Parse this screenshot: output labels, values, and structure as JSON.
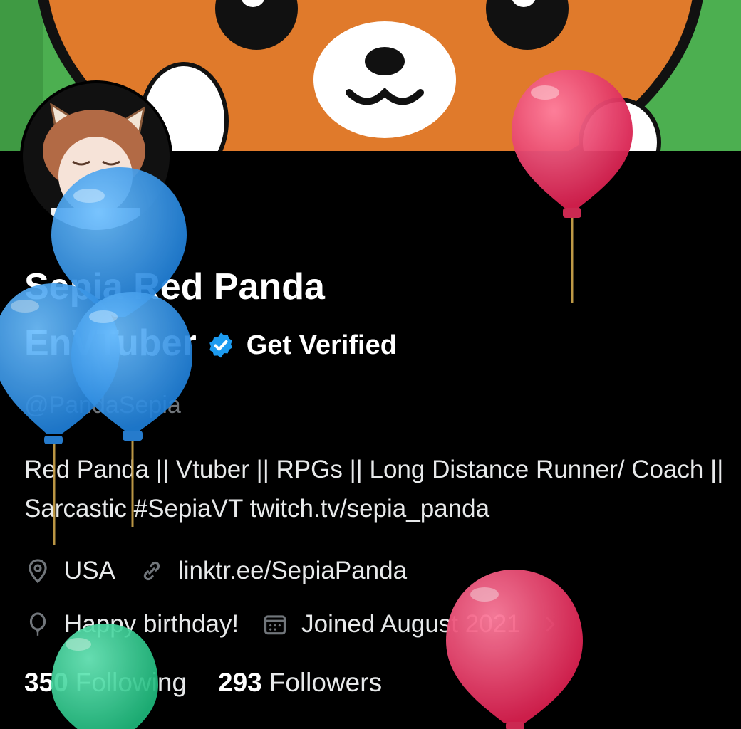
{
  "profile": {
    "name_line1": "Sepia Red Panda",
    "name_line2": "EnVTuber",
    "get_verified_label": "Get Verified",
    "handle": "@PandaSepia",
    "bio": "Red Panda || Vtuber || RPGs || Long Distance Runner/ Coach || Sarcastic #SepiaVT twitch.tv/sepia_panda",
    "location": "USA",
    "website": "linktr.ee/SepiaPanda",
    "birthday": "Happy birthday!",
    "joined": "Joined August 2021",
    "following_count": "350",
    "following_label": "Following",
    "followers_count": "293",
    "followers_label": "Followers"
  },
  "icons": {
    "verified": "verified-badge-icon",
    "location": "location-pin-icon",
    "link": "link-icon",
    "birthday": "balloon-icon",
    "calendar": "calendar-icon",
    "chevron": "chevron-right-icon"
  },
  "colors": {
    "background": "#000000",
    "banner_orange": "#e07a2b",
    "banner_green": "#4caf50",
    "verified_blue": "#1d9bf0",
    "secondary_text": "#71767b",
    "balloon_blue": "#2f8fe0",
    "balloon_red": "#e2355f",
    "balloon_green": "#2ecf8f"
  }
}
